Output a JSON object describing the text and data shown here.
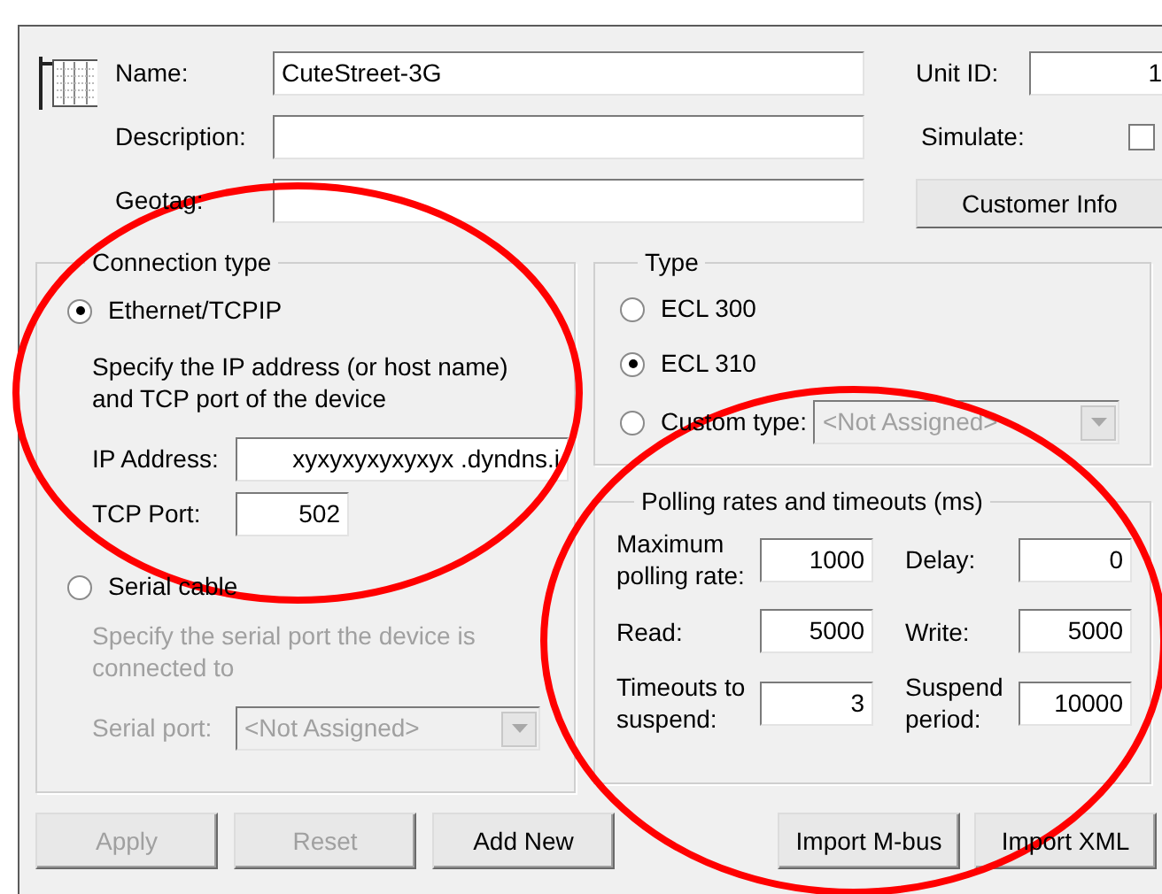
{
  "header": {
    "name": {
      "label": "Name:",
      "value": "CuteStreet-3G"
    },
    "description": {
      "label": "Description:"
    },
    "geotag": {
      "label": "Geotag:"
    },
    "unit_id": {
      "label": "Unit ID:",
      "value": "1"
    },
    "simulate": {
      "label": "Simulate:",
      "checked": false
    },
    "customer_info_button": "Customer Info"
  },
  "connection_type": {
    "title": "Connection type",
    "ethernet": {
      "label": "Ethernet/TCPIP",
      "selected": true,
      "disabled": false,
      "hint": "Specify the IP address (or host name) and TCP port of the device",
      "fields": [
        {
          "label": "IP Address:",
          "value": "xyxyxyxyxyxyx .dyndns.i"
        },
        {
          "label": "TCP Port:",
          "value": "502"
        }
      ]
    },
    "serial": {
      "label": "Serial cable",
      "selected": false,
      "disabled": true,
      "hint": "Specify the serial port the device is connected to",
      "port": {
        "label": "Serial port:",
        "value": "<Not Assigned>"
      }
    }
  },
  "type": {
    "title": "Type",
    "options": [
      {
        "label": "ECL 300",
        "selected": false
      },
      {
        "label": "ECL 310",
        "selected": true
      },
      {
        "label": "Custom type:",
        "selected": false,
        "combo": "<Not Assigned>",
        "disabled": true
      }
    ]
  },
  "polling": {
    "title": "Polling rates and timeouts (ms)",
    "fields": [
      {
        "label": "Maximum polling rate:",
        "value": "1000"
      },
      {
        "label": "Delay:",
        "value": "0"
      },
      {
        "label": "Read:",
        "value": "5000"
      },
      {
        "label": "Write:",
        "value": "5000"
      },
      {
        "label": "Timeouts to suspend:",
        "value": "3"
      },
      {
        "label": "Suspend period:",
        "value": "10000"
      }
    ]
  },
  "buttons_left": [
    {
      "label": "Apply",
      "disabled": true
    },
    {
      "label": "Reset",
      "disabled": true
    },
    {
      "label": "Add New",
      "disabled": false
    }
  ],
  "buttons_right": [
    {
      "label": "Import M-bus",
      "disabled": false
    },
    {
      "label": "Import XML",
      "disabled": false
    }
  ]
}
